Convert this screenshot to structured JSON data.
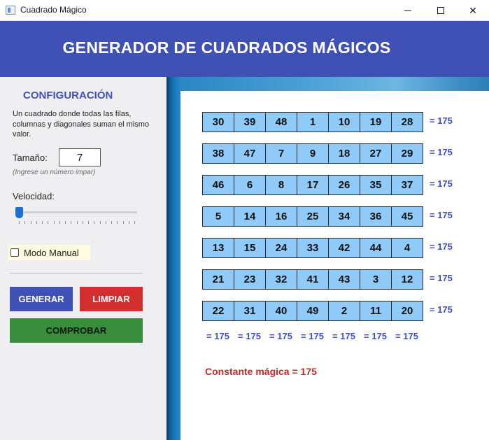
{
  "window": {
    "title": "Cuadrado Mágico",
    "minimize": "",
    "maximize": "",
    "close": "✕"
  },
  "header": {
    "title": "GENERADOR DE CUADRADOS MÁGICOS"
  },
  "sidebar": {
    "title": "CONFIGURACIÓN",
    "description": "Un cuadrado donde todas las filas, columnas y diagonales suman el mismo valor.",
    "size_label": "Tamaño:",
    "size_value": "7",
    "size_hint": "(Ingrese un número impar)",
    "speed_label": "Velocidad:",
    "speed_value": 0,
    "manual_label": "Modo Manual",
    "manual_checked": false,
    "generate_label": "GENERAR",
    "clear_label": "LIMPIAR",
    "check_label": "COMPROBAR",
    "colors": {
      "generate": "#3f51b5",
      "clear": "#d32f2f",
      "check": "#388e3c"
    }
  },
  "square": {
    "rows": [
      [
        30,
        39,
        48,
        1,
        10,
        19,
        28
      ],
      [
        38,
        47,
        7,
        9,
        18,
        27,
        29
      ],
      [
        46,
        6,
        8,
        17,
        26,
        35,
        37
      ],
      [
        5,
        14,
        16,
        25,
        34,
        36,
        45
      ],
      [
        13,
        15,
        24,
        33,
        42,
        44,
        4
      ],
      [
        21,
        23,
        32,
        41,
        43,
        3,
        12
      ],
      [
        22,
        31,
        40,
        49,
        2,
        11,
        20
      ]
    ],
    "row_sums": [
      "= 175",
      "= 175",
      "= 175",
      "= 175",
      "= 175",
      "= 175",
      "= 175"
    ],
    "col_sums": [
      "= 175",
      "= 175",
      "= 175",
      "= 175",
      "= 175",
      "= 175",
      "= 175"
    ],
    "constant_text": "Constante mágica = 175",
    "colors": {
      "cell": "#90caf9",
      "sum": "#3f51b5",
      "constant": "#c62828"
    }
  }
}
